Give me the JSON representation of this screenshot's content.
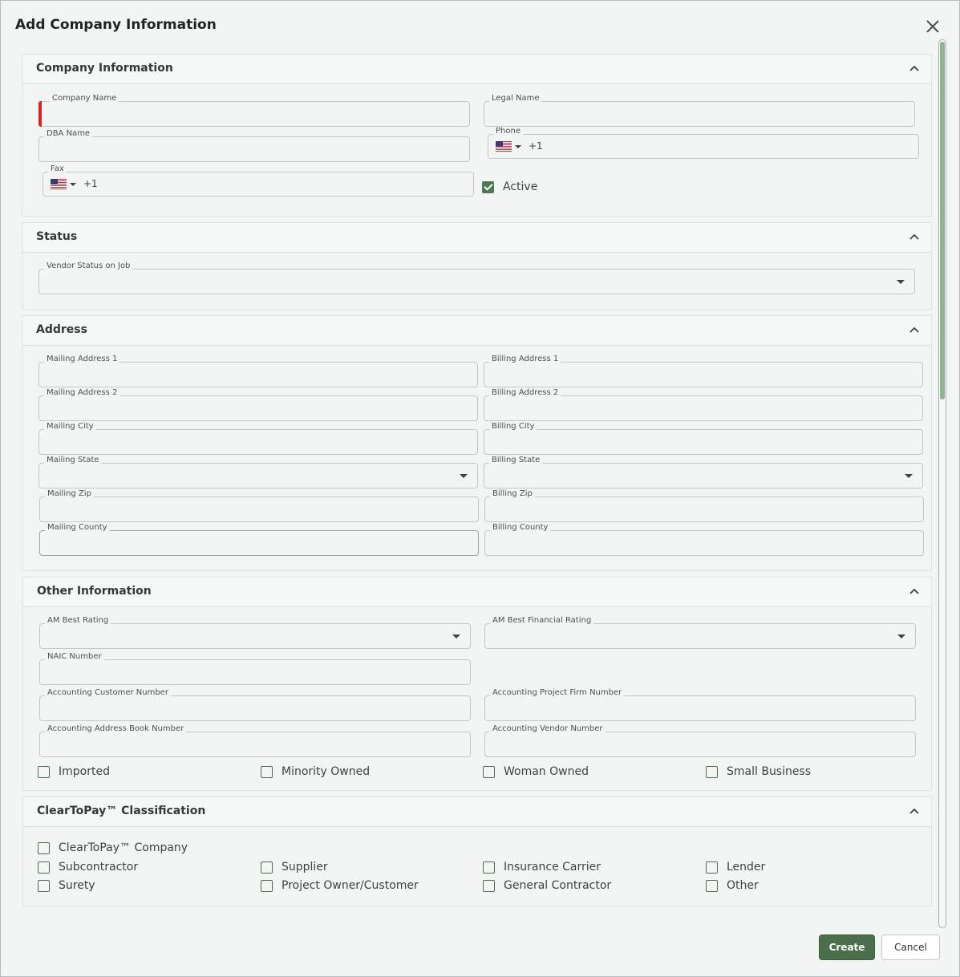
{
  "dialog": {
    "title": "Add Company Information",
    "close_icon": "close-icon"
  },
  "sections": {
    "company_info": {
      "title": "Company Information",
      "company_name_label": "Company Name",
      "legal_name_label": "Legal Name",
      "dba_name_label": "DBA Name",
      "phone_label": "Phone",
      "phone_code": "+1",
      "fax_label": "Fax",
      "fax_code": "+1",
      "active_label": "Active",
      "active_checked": true
    },
    "status": {
      "title": "Status",
      "vendor_status_label": "Vendor Status on Job"
    },
    "address": {
      "title": "Address",
      "mailing_address1": "Mailing Address 1",
      "billing_address1": "Billing Address 1",
      "mailing_address2": "Mailing Address 2",
      "billing_address2": "Billing Address 2",
      "mailing_city": "Mailing City",
      "billing_city": "Billing City",
      "mailing_state": "Mailing State",
      "billing_state": "Billing State",
      "mailing_zip": "Mailing Zip",
      "billing_zip": "Billing Zip",
      "mailing_county": "Mailing County",
      "billing_county": "Billing County"
    },
    "other": {
      "title": "Other Information",
      "am_best_rating": "AM Best Rating",
      "am_best_financial": "AM Best Financial Rating",
      "naic_number": "NAIC Number",
      "acct_customer": "Accounting Customer Number",
      "acct_project_firm": "Accounting Project Firm Number",
      "acct_address_book": "Accounting Address Book Number",
      "acct_vendor": "Accounting Vendor Number",
      "imported": "Imported",
      "minority_owned": "Minority Owned",
      "woman_owned": "Woman Owned",
      "small_business": "Small Business"
    },
    "cleartopay": {
      "title": "ClearToPay™ Classification",
      "company": "ClearToPay™ Company",
      "subcontractor": "Subcontractor",
      "supplier": "Supplier",
      "insurance_carrier": "Insurance Carrier",
      "lender": "Lender",
      "surety": "Surety",
      "project_owner": "Project Owner/Customer",
      "general_contractor": "General Contractor",
      "other": "Other"
    }
  },
  "footer": {
    "create_label": "Create",
    "cancel_label": "Cancel"
  },
  "colors": {
    "accent": "#4b6e4b",
    "required": "#d9261c",
    "scroll_thumb": "#8fb28f"
  }
}
